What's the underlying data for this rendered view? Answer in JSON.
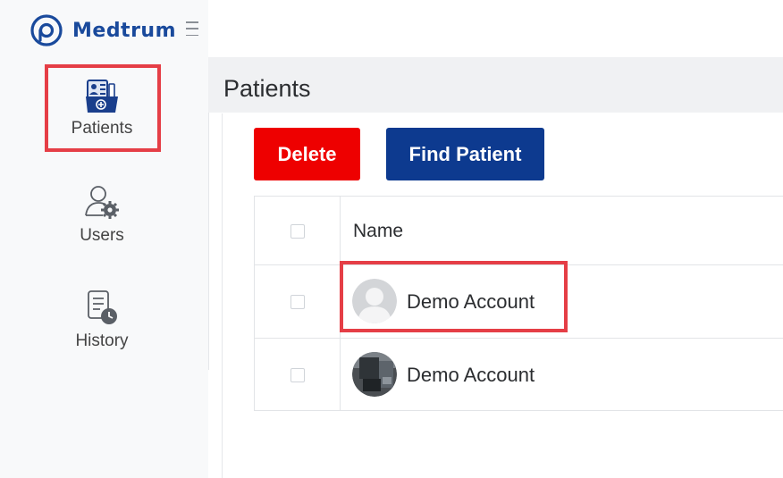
{
  "app": {
    "brand": "Medtrum",
    "accent_color": "#1a4a9c",
    "highlight_color": "#e53e46"
  },
  "sidebar": {
    "items": [
      {
        "label": "Patients",
        "icon": "patient-folder-icon",
        "selected": true
      },
      {
        "label": "Users",
        "icon": "user-settings-icon"
      },
      {
        "label": "History",
        "icon": "history-clock-icon"
      }
    ]
  },
  "page": {
    "title": "Patients"
  },
  "toolbar": {
    "delete_label": "Delete",
    "delete_color": "#ee0000",
    "find_label": "Find Patient",
    "find_color": "#0d3a8f"
  },
  "table": {
    "columns": [
      "Name"
    ],
    "rows": [
      {
        "name": "Demo Account",
        "avatar": "default-avatar-icon",
        "checked": false
      },
      {
        "name": "Demo Account",
        "avatar": "photo-avatar",
        "checked": false
      }
    ]
  }
}
